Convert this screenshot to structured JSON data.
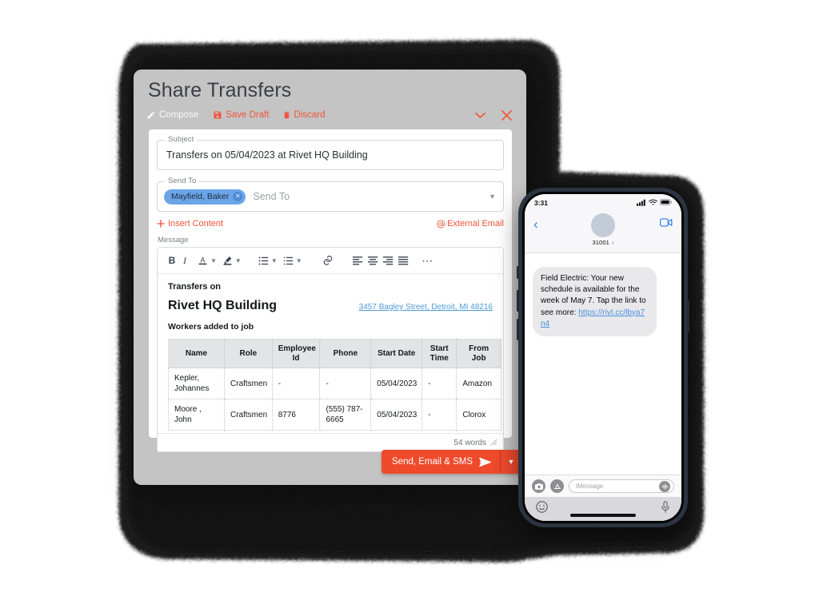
{
  "modal": {
    "title": "Share Transfers",
    "actions": [
      {
        "id": "compose",
        "label": "Compose",
        "icon": "pencil-icon"
      },
      {
        "id": "save-draft",
        "label": "Save Draft",
        "icon": "floppy-disk-icon"
      },
      {
        "id": "discard",
        "label": "Discard",
        "icon": "trash-icon"
      }
    ],
    "header_controls": [
      {
        "id": "collapse",
        "icon": "chevron-down-icon"
      },
      {
        "id": "close",
        "icon": "close-x-icon"
      }
    ],
    "accent_color": "#f4533a",
    "send_button_color": "#ef4a2c",
    "chrome_color": "#c4c4c4"
  },
  "subject": {
    "legend": "Subject",
    "value": "Transfers on 05/04/2023 at Rivet HQ Building"
  },
  "send_to": {
    "legend": "Send To",
    "chips": [
      {
        "label": "Mayfield, Baker",
        "remove_icon": "close-x-icon"
      }
    ],
    "placeholder": "Send To",
    "caret_icon": "caret-down-icon",
    "chip_color": "#6ba5e8"
  },
  "links": {
    "insert_content": "Insert Content",
    "insert_icon": "plus-icon",
    "external_email": "External Email",
    "external_icon": "at-sign-icon"
  },
  "message": {
    "label": "Message",
    "toolbar": [
      {
        "id": "bold",
        "icon": "bold-icon",
        "glyph": "B"
      },
      {
        "id": "italic",
        "icon": "italic-icon",
        "glyph": "I"
      },
      {
        "id": "font-color",
        "icon": "text-color-icon",
        "glyph": "A"
      },
      {
        "id": "font-color-caret",
        "icon": "chevron-down-icon"
      },
      {
        "id": "highlight",
        "icon": "highlighter-icon"
      },
      {
        "id": "highlight-caret",
        "icon": "chevron-down-icon"
      },
      {
        "id": "bulleted-list",
        "icon": "bulleted-list-icon"
      },
      {
        "id": "bulleted-list-caret",
        "icon": "chevron-down-icon"
      },
      {
        "id": "numbered-list",
        "icon": "numbered-list-icon"
      },
      {
        "id": "numbered-list-caret",
        "icon": "chevron-down-icon"
      },
      {
        "id": "link",
        "icon": "link-icon"
      },
      {
        "id": "align-left",
        "icon": "align-left-icon"
      },
      {
        "id": "align-center",
        "icon": "align-center-icon"
      },
      {
        "id": "align-right",
        "icon": "align-right-icon"
      },
      {
        "id": "align-justify",
        "icon": "align-justify-icon"
      },
      {
        "id": "more",
        "icon": "ellipsis-icon"
      }
    ],
    "word_count": "54 words",
    "resize_icon": "resize-grip-icon"
  },
  "document": {
    "line1": "Transfers on",
    "job_title": "Rivet HQ Building",
    "address": "3457 Bagley Street, Detroit, MI 48216",
    "section": "Workers added to job",
    "table": {
      "columns": [
        "Name",
        "Role",
        "Employee Id",
        "Phone",
        "Start Date",
        "Start Time",
        "From Job"
      ],
      "rows": [
        [
          "Kepler, Johannes",
          "Craftsmen",
          "-",
          "-",
          "05/04/2023",
          "-",
          "Amazon"
        ],
        [
          "Moore , John",
          "Craftsmen",
          "8776",
          "(555) 787-6665",
          "05/04/2023",
          "-",
          "Clorox"
        ]
      ]
    }
  },
  "send": {
    "label": "Send, Email & SMS",
    "send_icon": "paper-plane-icon",
    "split_icon": "caret-down-icon"
  },
  "phone": {
    "status": {
      "time": "3:31",
      "signal_icon": "cellular-bars-icon",
      "wifi_icon": "wifi-icon",
      "battery_icon": "battery-full-icon"
    },
    "navbar": {
      "back_icon": "back-chevron-icon",
      "avatar": "contact-avatar",
      "contact_name": "31001 ",
      "contact_chevron": "chevron-right-icon",
      "facetime_icon": "video-camera-icon"
    },
    "message": {
      "text": "Field Electric: Your new schedule is available for the week of May 7. Tap the link to see more: ",
      "link": "https://rivt.cc/lbya7n4"
    },
    "input_bar": {
      "camera_icon": "camera-icon",
      "appstore_icon": "app-store-icon",
      "placeholder": "iMessage",
      "audio_icon": "audio-wave-icon",
      "emoji_icon": "emoji-smiley-icon",
      "mic_icon": "microphone-icon"
    }
  }
}
